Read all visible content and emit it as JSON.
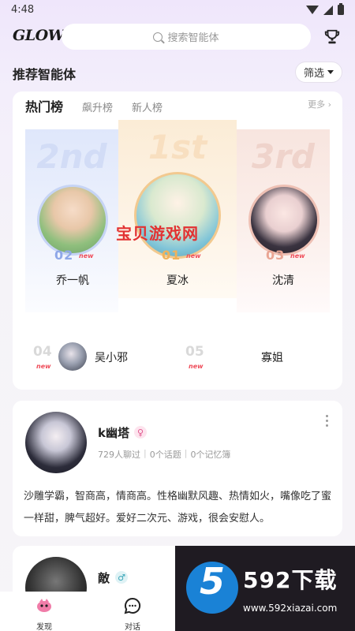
{
  "status": {
    "time": "4:48"
  },
  "header": {
    "logo": "GLOW",
    "search_placeholder": "搜索智能体"
  },
  "section": {
    "title": "推荐智能体",
    "filter_label": "筛选"
  },
  "rank_tabs": [
    "热门榜",
    "飙升榜",
    "新人榜"
  ],
  "more_label": "更多 ›",
  "podium": [
    {
      "big_rank": "2nd",
      "num": "02",
      "badge": "new",
      "name": "乔一帆",
      "num_color": "#8fa8e8"
    },
    {
      "big_rank": "1st",
      "num": "01",
      "badge": "new",
      "name": "夏冰",
      "num_color": "#f0b25a"
    },
    {
      "big_rank": "3rd",
      "num": "03",
      "badge": "new",
      "name": "沈清",
      "num_color": "#e9a594"
    }
  ],
  "list": [
    {
      "num": "04",
      "badge": "new",
      "name": "吴小邪"
    },
    {
      "num": "05",
      "badge": "new",
      "name": "寡姐"
    }
  ],
  "watermark": "宝贝游戏网",
  "posts": [
    {
      "name": "k幽塔",
      "gender": "♀",
      "stats": [
        "729人聊过",
        "0个话题",
        "0个记忆簿"
      ],
      "description": "沙雕学霸，智商高，情商高。性格幽默风趣、热情如火，嘴像吃了蜜一样甜，脾气超好。爱好二次元、游戏，很会安慰人。"
    },
    {
      "name": "敵",
      "gender": "♂"
    }
  ],
  "nav": [
    {
      "label": "发现"
    },
    {
      "label": "对话"
    }
  ],
  "ad": {
    "logo_text": "5",
    "title": "592下载",
    "url": "www.592xiazai.com"
  },
  "colors": {
    "accent_new": "#ef4d5a",
    "ad_blue": "#1a82d6"
  }
}
